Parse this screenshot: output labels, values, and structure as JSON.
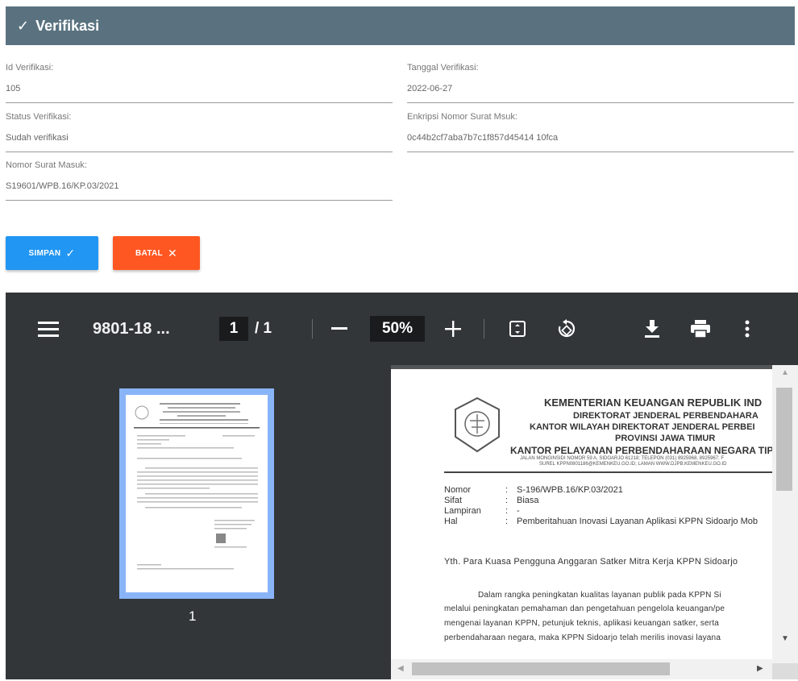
{
  "header": {
    "title": "Verifikasi"
  },
  "form": {
    "id_label": "Id Verifikasi:",
    "id_value": "105",
    "tanggal_label": "Tanggal Verifikasi:",
    "tanggal_value": "2022-06-27",
    "status_label": "Status Verifikasi:",
    "status_value": "Sudah verifikasi",
    "enkripsi_label": "Enkripsi Nomor Surat Msuk:",
    "enkripsi_value": "0c44b2cf7aba7b7c1f857d45414 10fca",
    "nomor_label": "Nomor Surat Masuk:",
    "nomor_value": "S19601/WPB.16/KP.03/2021"
  },
  "buttons": {
    "simpan": "SIMPAN",
    "batal": "BATAL"
  },
  "viewer": {
    "title": "9801-18 ...",
    "page_current": "1",
    "page_total": "/  1",
    "zoom": "50%",
    "thumbnail_number": "1",
    "document": {
      "org1": "KEMENTERIAN KEUANGAN REPUBLIK IND",
      "org2": "DIREKTORAT JENDERAL PERBENDAHARA",
      "org3": "KANTOR WILAYAH DIREKTORAT JENDERAL PERBEI",
      "org4": "PROVINSI JAWA TIMUR",
      "org5": "KANTOR PELAYANAN PERBENDAHARAAN NEGARA TIP",
      "address1": "JALAN MONGINSIDI NOMOR 59 A, SIDOARJO 61218; TELEPON (031) 8925968, 8925967; F",
      "address2": "SUREL KPPN0801186@KEMENKEU.GO.ID; LAMAN WWW.DJPB.KEMENKEU.GO.ID",
      "meta": [
        {
          "k": "Nomor",
          "v": "S-196/WPB.16/KP.03/2021"
        },
        {
          "k": "Sifat",
          "v": "Biasa"
        },
        {
          "k": "Lampiran",
          "v": "-"
        },
        {
          "k": "Hal",
          "v": "Pemberitahuan Inovasi Layanan Aplikasi KPPN Sidoarjo Mob"
        }
      ],
      "salutation": "Yth.  Para Kuasa Pengguna Anggaran Satker Mitra Kerja KPPN Sidoarjo",
      "para1": "Dalam  rangka  peningkatan  kualitas  layanan  publik  pada  KPPN  Si",
      "para2": "melalui  peningkatan  pemahaman  dan  pengetahuan  pengelola  keuangan/pe",
      "para3": "mengenai  layanan  KPPN,  petunjuk  teknis,  aplikasi  keuangan  satker,  serta",
      "para4": "perbendaharaan  negara,  maka  KPPN  Sidoarjo  telah  merilis  inovasi  layana"
    }
  }
}
